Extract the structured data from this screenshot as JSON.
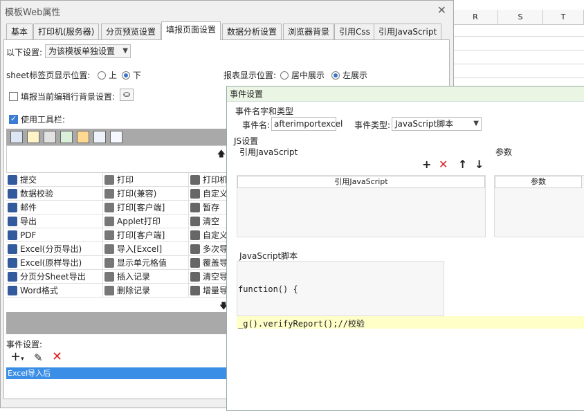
{
  "background_sheet": {
    "columns": [
      "R",
      "S",
      "T"
    ]
  },
  "main_window": {
    "title": "模板Web属性",
    "tabs": [
      "基本",
      "打印机(服务器)",
      "分页预览设置",
      "填报页面设置",
      "数据分析设置",
      "浏览器背景",
      "引用Css",
      "引用JavaScript"
    ],
    "active_tab": "填报页面设置",
    "settings_label": "以下设置:",
    "settings_value": "为该模板单独设置",
    "sheet_tab_pos_label": "sheet标签页显示位置:",
    "sheet_tab_pos_options": [
      "上",
      "下"
    ],
    "sheet_tab_pos_selected": "下",
    "report_pos_label": "报表显示位置:",
    "report_pos_options": [
      "居中展示",
      "左展示"
    ],
    "report_pos_selected": "左展示",
    "fill_bg_label": "填报当前编辑行背景设置:",
    "use_toolbar_label": "使用工具栏:",
    "toolbar_buttons": [
      [
        "提交",
        "打印",
        "打印机"
      ],
      [
        "数据校验",
        "打印(兼容)",
        "自定义"
      ],
      [
        "邮件",
        "打印[客户端]",
        "暂存"
      ],
      [
        "导出",
        "Applet打印",
        "清空"
      ],
      [
        "PDF",
        "打印[客户端]",
        "自定义"
      ],
      [
        "Excel(分页导出)",
        "导入[Excel]",
        "多次导"
      ],
      [
        "Excel(原样导出)",
        "显示单元格值",
        "覆盖导"
      ],
      [
        "分页分Sheet导出",
        "插入记录",
        "清空导"
      ],
      [
        "Word格式",
        "删除记录",
        "增量导"
      ]
    ],
    "event_settings_label": "事件设置:",
    "event_selected": "Excel导入后"
  },
  "event_dialog": {
    "title": "事件设置",
    "section_name_type": "事件名字和类型",
    "event_name_label": "事件名:",
    "event_name_value": "afterimportexcel",
    "event_type_label": "事件类型:",
    "event_type_value": "JavaScript脚本",
    "js_section": "JS设置",
    "ref_js_label": "引用JavaScript",
    "params_label": "参数",
    "ref_js_col": "引用JavaScript",
    "params_col": "参数",
    "script_label": "JavaScript脚本",
    "code_line1": "function() {",
    "code_line2": "_g().verifyReport();//校验"
  }
}
